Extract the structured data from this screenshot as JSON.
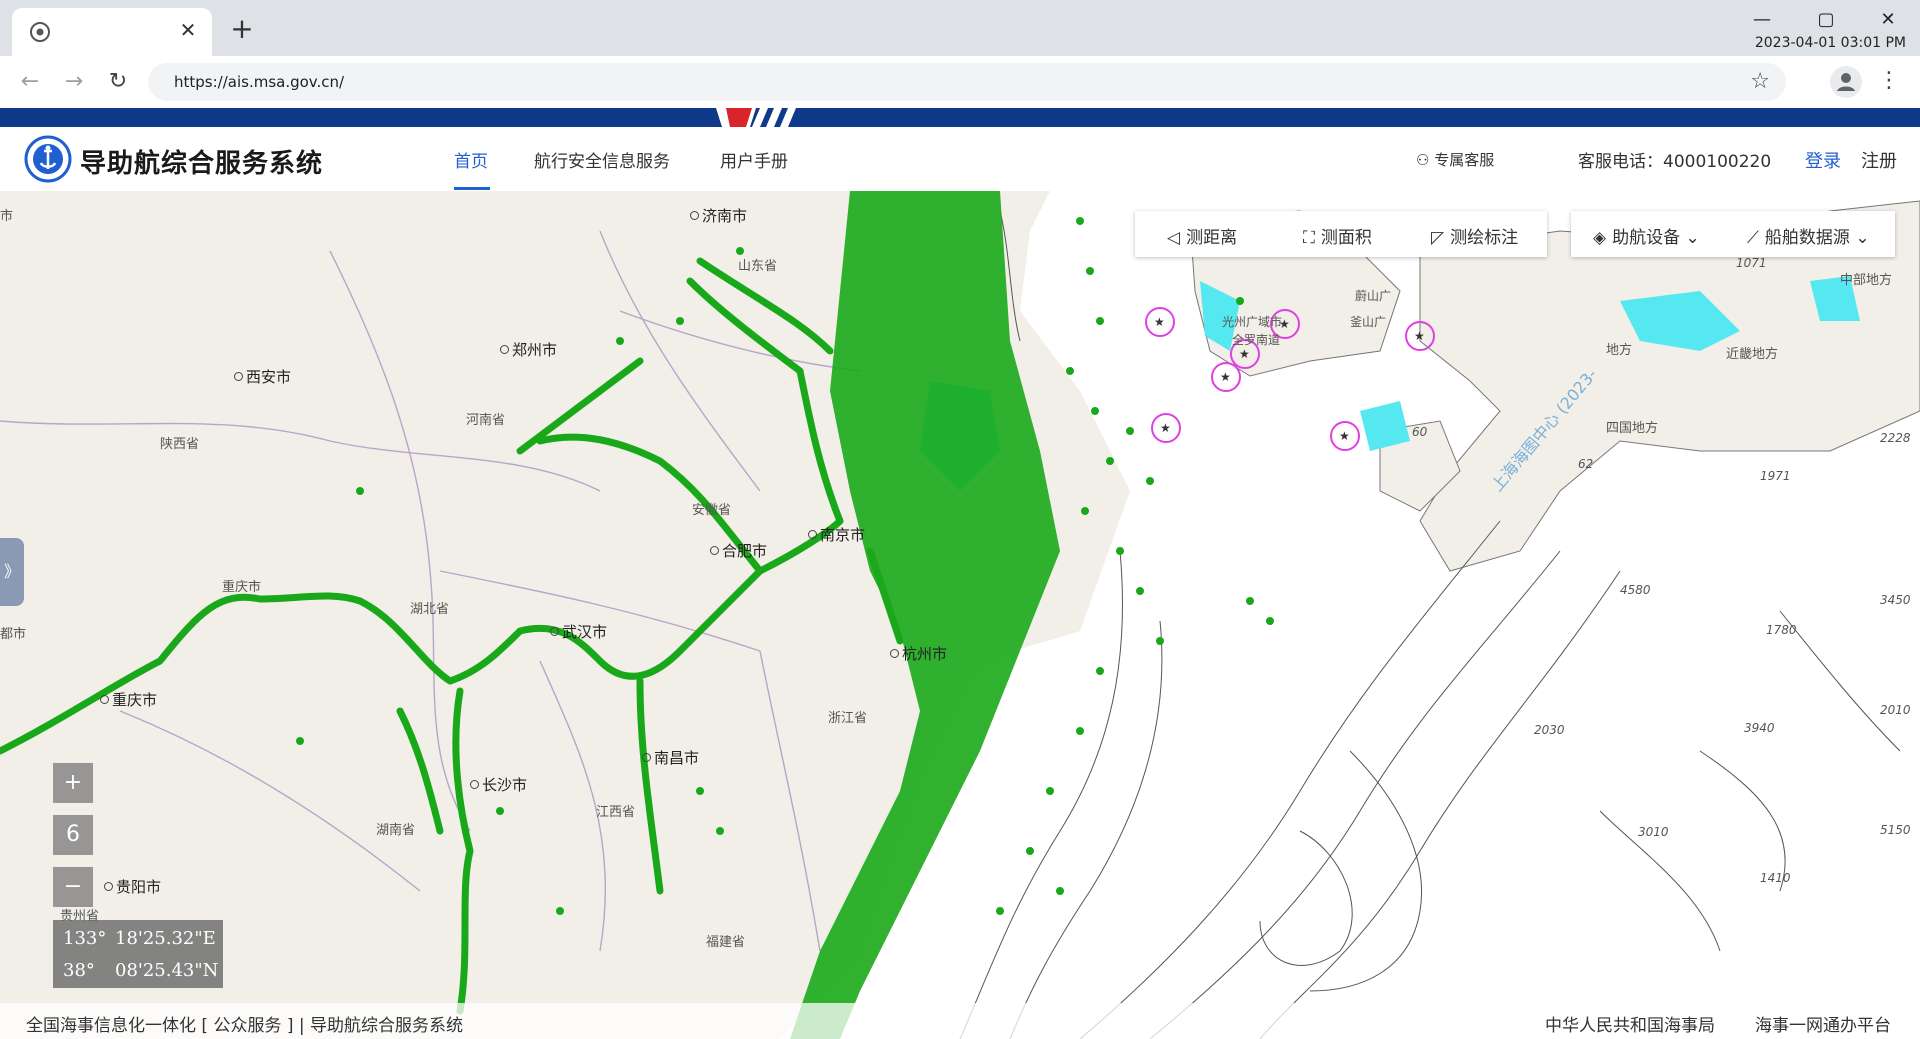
{
  "browser": {
    "url": "https://ais.msa.gov.cn/",
    "clock": "2023-04-01 03:01 PM",
    "tab_close": "✕",
    "new_tab": "+"
  },
  "site": {
    "title": "导助航综合服务系统",
    "nav": [
      "首页",
      "航行安全信息服务",
      "用户手册"
    ],
    "service": "专属客服",
    "hotline": "客服电话：4000100220",
    "login": "登录",
    "register": "注册"
  },
  "toolbar": {
    "measure_distance": "测距离",
    "measure_area": "测面积",
    "annotate": "测绘标注",
    "aids": "助航设备",
    "ship_source": "船舶数据源"
  },
  "map": {
    "labels": {
      "jinan": "济南市",
      "shandong": "山东省",
      "zhengzhou": "郑州市",
      "xian": "西安市",
      "henan": "河南省",
      "shaanxi": "陕西省",
      "anhui": "安徽省",
      "hefei": "合肥市",
      "nanjing": "南京市",
      "chongqing1": "重庆市",
      "hubei": "湖北省",
      "wuhan": "武汉市",
      "hangzhou": "杭州市",
      "zhejiang": "浙江省",
      "chongqing2": "重庆市",
      "changsha": "长沙市",
      "nanchang": "南昌市",
      "hunan": "湖南省",
      "jiangxi": "江西省",
      "guiyang": "贵阳市",
      "guizhou": "贵州省",
      "fujian": "福建省",
      "shi": "市",
      "du": "都市",
      "gwangju": "光州广域市",
      "jeolla": "全罗南道",
      "ulsan": "蔚山广",
      "busan": "釜山广",
      "chugoku": "中部地方",
      "kinki": "近畿地方",
      "shikoku": "四国地方",
      "difang": "地方",
      "watermark": "上海海图中心 (2023-"
    },
    "depths": [
      "1071",
      "2228",
      "1971",
      "3450",
      "4580",
      "1780",
      "2010",
      "3940",
      "2030",
      "5150",
      "3010",
      "1410",
      "60",
      "62"
    ],
    "zoom_in": "+",
    "zoom_level": "6",
    "zoom_out": "−",
    "lon_deg": "133°",
    "lon_min": "18'25.32\"E",
    "lat_deg": "38°",
    "lat_min": "08'25.43\"N",
    "side_toggle": "》"
  },
  "footer": {
    "left": "全国海事信息化一体化 [ 公众服务 ] | 导助航综合服务系统",
    "right1": "中华人民共和国海事局",
    "right2": "海事一网通办平台"
  },
  "colors": {
    "accent": "#1f5fd0",
    "topbar": "#0f3a8a",
    "ais": "#1aab1a",
    "water": "#56e8f0"
  }
}
